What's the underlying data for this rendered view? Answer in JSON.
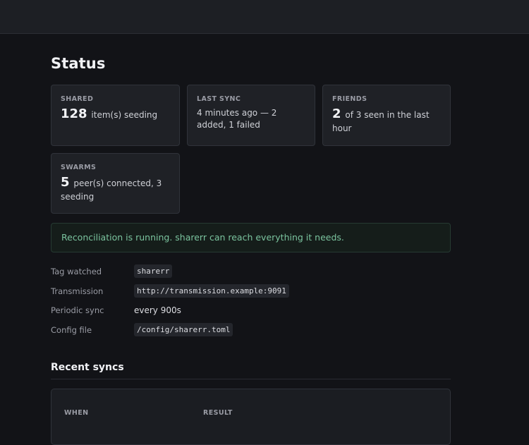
{
  "page": {
    "title": "Status"
  },
  "cards": {
    "shared": {
      "label": "SHARED",
      "big": "128",
      "rest": "item(s) seeding"
    },
    "last_sync": {
      "label": "LAST SYNC",
      "text": "4 minutes ago — 2 added, 1 failed"
    },
    "friends": {
      "label": "FRIENDS",
      "big": "2",
      "rest": "of 3 seen in the last hour"
    },
    "swarms": {
      "label": "SWARMS",
      "big": "5",
      "rest": "peer(s) connected, 3 seeding"
    }
  },
  "alert": {
    "text": "Reconciliation is running. sharerr can reach everything it needs."
  },
  "details": {
    "tag_watched": {
      "label": "Tag watched",
      "value": "sharerr"
    },
    "transmission": {
      "label": "Transmission",
      "value": "http://transmission.example:9091"
    },
    "periodic_sync": {
      "label": "Periodic sync",
      "value": "every 900s"
    },
    "config_file": {
      "label": "Config file",
      "value": "/config/sharerr.toml"
    }
  },
  "recent": {
    "title": "Recent syncs",
    "columns": [
      "WHEN",
      "RESULT"
    ]
  },
  "colors": {
    "background": "#121317",
    "card": "#1f2126",
    "success_text": "#7bc49f"
  }
}
